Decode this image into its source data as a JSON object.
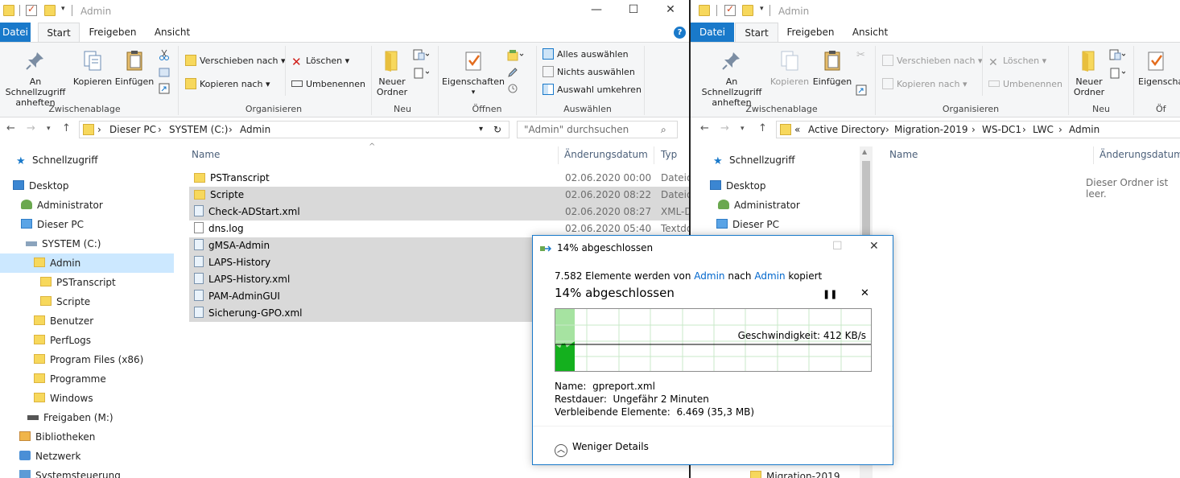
{
  "left": {
    "title": "Admin",
    "tabs": [
      "Datei",
      "Start",
      "Freigeben",
      "Ansicht"
    ],
    "ribbon": {
      "pin": "An Schnellzugriff anheften",
      "copy": "Kopieren",
      "paste": "Einfügen",
      "clipboard_group": "Zwischenablage",
      "move_to": "Verschieben nach",
      "copy_to": "Kopieren nach",
      "delete": "Löschen",
      "rename": "Umbenennen",
      "organize_group": "Organisieren",
      "new_folder": "Neuer Ordner",
      "new_group": "Neu",
      "properties": "Eigenschaften",
      "open_group": "Öffnen",
      "select_all": "Alles auswählen",
      "select_none": "Nichts auswählen",
      "invert_selection": "Auswahl umkehren",
      "select_group": "Auswählen"
    },
    "breadcrumb": [
      "Dieser PC",
      "SYSTEM (C:)",
      "Admin"
    ],
    "search_placeholder": "\"Admin\" durchsuchen",
    "nav": [
      "Schnellzugriff",
      "Desktop",
      "Administrator",
      "Dieser PC",
      "SYSTEM (C:)",
      "Admin",
      "PSTranscript",
      "Scripte",
      "Benutzer",
      "PerfLogs",
      "Program Files (x86)",
      "Programme",
      "Windows",
      "Freigaben (M:)",
      "Bibliotheken",
      "Netzwerk",
      "Systemsteuerung"
    ],
    "columns": {
      "name": "Name",
      "date": "Änderungsdatum",
      "type": "Typ"
    },
    "files": [
      {
        "name": "PSTranscript",
        "date": "02.06.2020 00:00",
        "type": "Dateio"
      },
      {
        "name": "Scripte",
        "date": "02.06.2020 08:22",
        "type": "Dateio"
      },
      {
        "name": "Check-ADStart.xml",
        "date": "02.06.2020 08:27",
        "type": "XML-D"
      },
      {
        "name": "dns.log",
        "date": "02.06.2020 05:40",
        "type": "Textdo"
      },
      {
        "name": "gMSA-Admin",
        "date": "",
        "type": ""
      },
      {
        "name": "LAPS-History",
        "date": "",
        "type": ""
      },
      {
        "name": "LAPS-History.xml",
        "date": "",
        "type": ""
      },
      {
        "name": "PAM-AdminGUI",
        "date": "",
        "type": ""
      },
      {
        "name": "Sicherung-GPO.xml",
        "date": "",
        "type": ""
      }
    ]
  },
  "right": {
    "title": "Admin",
    "tabs": [
      "Datei",
      "Start",
      "Freigeben",
      "Ansicht"
    ],
    "ribbon": {
      "pin": "An Schnellzugriff anheften",
      "copy": "Kopieren",
      "paste": "Einfügen",
      "clipboard_group": "Zwischenablage",
      "move_to": "Verschieben nach",
      "copy_to": "Kopieren nach",
      "delete": "Löschen",
      "rename": "Umbenennen",
      "organize_group": "Organisieren",
      "new_folder": "Neuer Ordner",
      "new_group": "Neu",
      "properties": "Eigenscha",
      "open_group": "Öf"
    },
    "breadcrumb_prefix": "«",
    "breadcrumb": [
      "Active Directory",
      "Migration-2019",
      "WS-DC1",
      "LWC",
      "Admin"
    ],
    "nav": [
      "Schnellzugriff",
      "Desktop",
      "Administrator",
      "Dieser PC",
      "Migration-2019"
    ],
    "columns": {
      "name": "Name",
      "date": "Änderungsdatum"
    },
    "empty_text": "Dieser Ordner ist leer."
  },
  "dialog": {
    "title": "14% abgeschlossen",
    "status_count": "7.582 Elemente werden von",
    "status_src": "Admin",
    "status_mid": "nach",
    "status_dst": "Admin",
    "status_end": "kopiert",
    "progress_heading": "14% abgeschlossen",
    "progress": 0.14,
    "speed": "Geschwindigkeit: 412 KB/s",
    "name_label": "Name:",
    "name_value": "gpreport.xml",
    "remaining_label": "Restdauer:",
    "remaining_value": "Ungefähr 2 Minuten",
    "items_label": "Verbleibende Elemente:",
    "items_value": "6.469 (35,3 MB)",
    "less_details": "Weniger Details",
    "colors": {
      "progress_fill": "#a6e3a1",
      "throughput": "#14b01e",
      "accent": "#1979ca"
    }
  }
}
